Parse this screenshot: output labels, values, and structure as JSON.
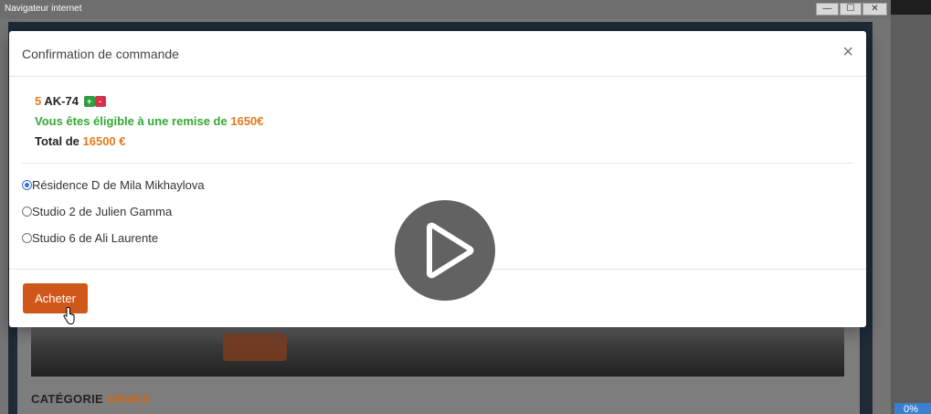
{
  "window": {
    "title": "Navigateur internet",
    "controls": [
      "—",
      "☐",
      "✕"
    ]
  },
  "page": {
    "category_label": "CATÉGORIE",
    "category_value": "ARMES"
  },
  "taskbar": {
    "badge_text": "0%"
  },
  "modal": {
    "title": "Confirmation de commande",
    "close_symbol": "×",
    "order": {
      "quantity": "5",
      "item": "AK-74",
      "plus": "+",
      "minus": "-",
      "discount_text": "Vous êtes éligible à une remise de",
      "discount_amount": "1650€",
      "total_text": "Total de",
      "total_amount": "16500 €"
    },
    "addresses": [
      {
        "label": "Résidence D de Mila Mikhaylova",
        "checked": true
      },
      {
        "label": "Studio 2 de Julien Gamma",
        "checked": false
      },
      {
        "label": "Studio 6 de Ali Laurente",
        "checked": false
      }
    ],
    "buy_label": "Acheter"
  },
  "colors": {
    "accent_orange": "#e07b1f",
    "buy_button": "#d0571a",
    "discount_green": "#34a834"
  }
}
